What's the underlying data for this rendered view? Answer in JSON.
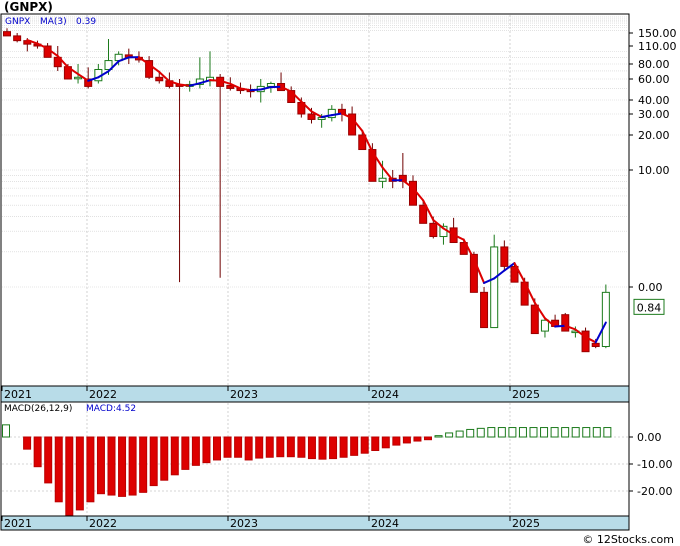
{
  "title": "(GNPX)",
  "watermark": "© 12Stocks.com",
  "chart_data": [
    {
      "type": "candlestick",
      "ticker_label": "GNPX",
      "ma_label": "MA(3)",
      "ma_value": "0.39",
      "last_price_badge": "0.84",
      "y_scale": "log",
      "y_ticks": [
        {
          "label": "150.00",
          "v": 150
        },
        {
          "label": "110.00",
          "v": 110
        },
        {
          "label": "80.00",
          "v": 80
        },
        {
          "label": "60.00",
          "v": 60
        },
        {
          "label": "40.00",
          "v": 40
        },
        {
          "label": "30.00",
          "v": 30
        },
        {
          "label": "20.00",
          "v": 20
        },
        {
          "label": "10.00",
          "v": 10
        },
        {
          "label": "0.00",
          "v": 1
        }
      ],
      "x_ticks": [
        "2021",
        "2022",
        "2023",
        "2024",
        "2025"
      ],
      "colors": {
        "up": "#1b7a1b",
        "down": "#dd0000",
        "ma_up": "#0000cc",
        "ma_down": "#dd0000",
        "badge": "#1b7a1b"
      },
      "candles": [
        [
          155,
          168,
          140,
          140
        ],
        [
          140,
          150,
          120,
          125
        ],
        [
          125,
          133,
          100,
          115
        ],
        [
          115,
          125,
          105,
          110
        ],
        [
          110,
          118,
          90,
          90
        ],
        [
          90,
          110,
          70,
          76
        ],
        [
          76,
          80,
          60,
          60
        ],
        [
          62,
          80,
          55,
          62
        ],
        [
          60,
          75,
          50,
          52
        ],
        [
          58,
          80,
          55,
          72
        ],
        [
          72,
          130,
          65,
          85
        ],
        [
          85,
          100,
          78,
          95
        ],
        [
          94,
          105,
          80,
          90
        ],
        [
          90,
          100,
          82,
          86
        ],
        [
          85,
          92,
          60,
          62
        ],
        [
          62,
          70,
          55,
          58
        ],
        [
          58,
          68,
          50,
          52
        ],
        [
          54,
          60,
          1.1,
          52
        ],
        [
          52,
          58,
          47,
          54
        ],
        [
          54,
          90,
          50,
          60
        ],
        [
          58,
          100,
          52,
          62
        ],
        [
          62,
          66,
          1.2,
          52
        ],
        [
          53,
          62,
          48,
          50
        ],
        [
          50,
          56,
          45,
          48
        ],
        [
          49,
          54,
          42,
          47
        ],
        [
          47,
          60,
          38,
          52
        ],
        [
          52,
          57,
          46,
          55
        ],
        [
          55,
          68,
          50,
          48
        ],
        [
          48,
          52,
          38,
          38
        ],
        [
          38,
          42,
          28,
          30
        ],
        [
          30,
          34,
          25,
          27
        ],
        [
          27,
          30,
          23,
          28
        ],
        [
          28,
          36,
          26,
          33
        ],
        [
          33,
          37,
          26,
          30
        ],
        [
          30,
          35,
          22,
          20
        ],
        [
          20,
          22,
          15,
          15
        ],
        [
          15,
          17,
          8,
          8
        ],
        [
          8,
          12,
          7,
          8.5
        ],
        [
          8.5,
          10,
          7,
          8
        ],
        [
          9,
          14,
          7,
          8
        ],
        [
          8,
          9,
          5,
          5
        ],
        [
          5,
          5.5,
          3.5,
          3.5
        ],
        [
          3.5,
          4,
          2.6,
          2.7
        ],
        [
          2.7,
          3.5,
          2.3,
          3.3
        ],
        [
          3.2,
          3.9,
          2.7,
          2.4
        ],
        [
          2.4,
          2.6,
          1.9,
          1.9
        ],
        [
          1.9,
          2,
          0.9,
          0.9
        ],
        [
          0.9,
          1,
          0.45,
          0.45
        ],
        [
          0.45,
          2.8,
          0.45,
          2.2
        ],
        [
          2.2,
          2.5,
          1.4,
          1.5
        ],
        [
          1.5,
          1.6,
          1.1,
          1.1
        ],
        [
          1.1,
          1.2,
          0.7,
          0.7
        ],
        [
          0.7,
          0.8,
          0.4,
          0.4
        ],
        [
          0.42,
          0.55,
          0.37,
          0.52
        ],
        [
          0.52,
          0.58,
          0.45,
          0.46
        ],
        [
          0.58,
          0.6,
          0.44,
          0.42
        ],
        [
          0.42,
          0.46,
          0.37,
          0.42
        ],
        [
          0.42,
          0.45,
          0.28,
          0.28
        ],
        [
          0.33,
          0.36,
          0.3,
          0.31
        ],
        [
          0.31,
          1.05,
          0.3,
          0.9
        ]
      ]
    },
    {
      "type": "bar",
      "label": "MACD(26,12,9)",
      "value_label": "MACD:4.52",
      "y_ticks": [
        {
          "label": "0.00",
          "v": 0
        },
        {
          "label": "-10.00",
          "v": -10
        },
        {
          "label": "-20.00",
          "v": -20
        }
      ],
      "values": [
        4.5,
        0,
        -4.5,
        -11,
        -17,
        -24,
        -29,
        -27,
        -24,
        -21,
        -21.5,
        -22,
        -21.5,
        -20.5,
        -18,
        -16,
        -14,
        -12,
        -10.5,
        -9.5,
        -8.5,
        -7.5,
        -7.5,
        -8.5,
        -7.8,
        -7.5,
        -7.3,
        -7.3,
        -7.5,
        -8,
        -8.2,
        -8,
        -7.5,
        -6.8,
        -6,
        -5,
        -4,
        -3,
        -2.2,
        -1.5,
        -1,
        0.5,
        1.5,
        2.2,
        2.8,
        3.2,
        3.5,
        3.5,
        3.5,
        3.5,
        3.5,
        3.5,
        3.5,
        3.5,
        3.5,
        3.5,
        3.5,
        3.5
      ]
    }
  ]
}
